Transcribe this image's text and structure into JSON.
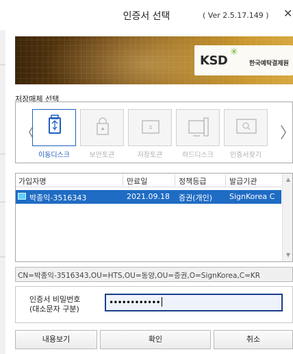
{
  "dialog": {
    "title": "인증서 선택",
    "version": "( Ver 2.5.17.149 )",
    "close_glyph": "✕"
  },
  "banner": {
    "logo_text": "KSD",
    "org_name": "한국예탁결제원",
    "logo_accent_color": "#78b52f"
  },
  "media_section": {
    "label": "저장매체 선택",
    "prev_arrow": "〈",
    "next_arrow": "〉",
    "items": [
      {
        "label": "이동디스크",
        "icon": "usb-icon",
        "glyph": "⎙",
        "active": true
      },
      {
        "label": "보안토큰",
        "icon": "lock-icon",
        "glyph": "🔒",
        "active": false
      },
      {
        "label": "저장토큰",
        "icon": "token-icon",
        "glyph": "▭",
        "active": false
      },
      {
        "label": "하드디스크",
        "icon": "monitor-icon",
        "glyph": "🖵",
        "active": false
      },
      {
        "label": "인증서찾기",
        "icon": "search-icon",
        "glyph": "⌕",
        "active": false
      }
    ],
    "active_color": "#1f5fbf"
  },
  "cert_table": {
    "columns": [
      "가입자명",
      "만료일",
      "정책등급",
      "발급기관"
    ],
    "rows": [
      {
        "name": "박종익-3516343",
        "expiry": "2021.09.18",
        "policy": "증권(개인)",
        "issuer": "SignKorea C",
        "selected": true
      }
    ],
    "selected_color": "#1f6cc4"
  },
  "dn_text": "CN=박종익-3516343,OU=HTS,OU=동양,OU=증권,O=SignKorea,C=KR",
  "password": {
    "label_line1": "인증서 비밀번호",
    "label_line2": "(대소문자 구분)",
    "masked_value": "••••••••••••"
  },
  "buttons": {
    "view": "내용보기",
    "ok": "확인",
    "cancel": "취소"
  }
}
